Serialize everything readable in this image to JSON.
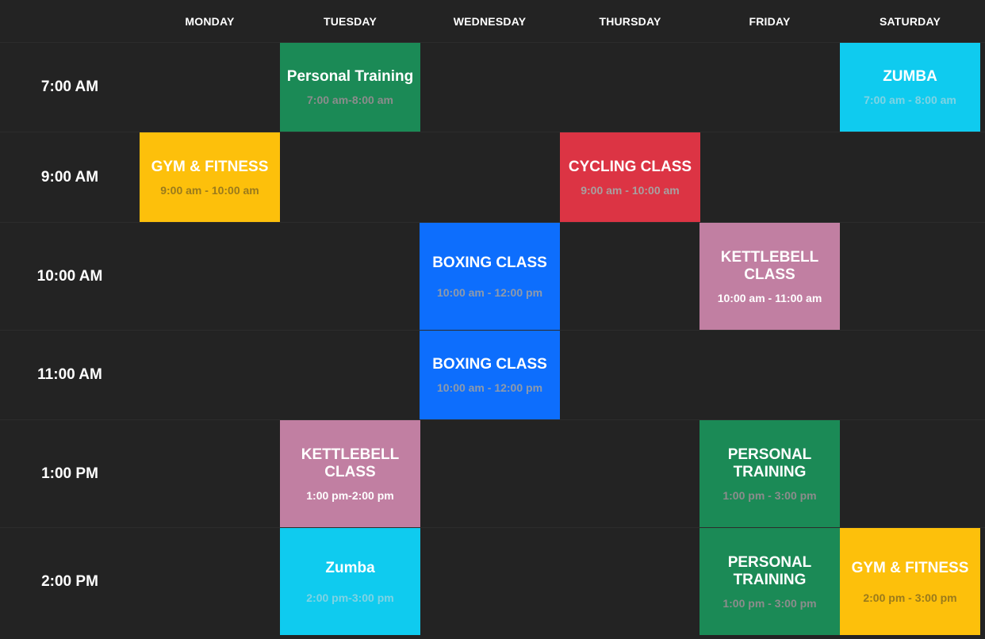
{
  "days": [
    "MONDAY",
    "TUESDAY",
    "WEDNESDAY",
    "THURSDAY",
    "FRIDAY",
    "SATURDAY"
  ],
  "rows": [
    {
      "time": "7:00 AM"
    },
    {
      "time": "9:00 AM"
    },
    {
      "time": "10:00 AM"
    },
    {
      "time": "11:00 AM"
    },
    {
      "time": "1:00 PM"
    },
    {
      "time": "2:00 PM"
    }
  ],
  "events": {
    "r0_tue": {
      "title": "Personal Training",
      "time": "7:00 am-8:00 am",
      "color": "#1b8a56"
    },
    "r0_sat": {
      "title": "ZUMBA",
      "time": "7:00 am - 8:00 am",
      "color": "#0fcbef"
    },
    "r1_mon": {
      "title": "GYM & FITNESS",
      "time": "9:00 am - 10:00 am",
      "color": "#fdc00b"
    },
    "r1_thu": {
      "title": "CYCLING CLASS",
      "time": "9:00 am - 10:00 am",
      "color": "#dc3444"
    },
    "r2_wed": {
      "title": "BOXING CLASS",
      "time": "10:00 am - 12:00 pm",
      "color": "#0d6efd"
    },
    "r2_fri": {
      "title": "KETTLEBELL CLASS",
      "time": "10:00 am - 11:00 am",
      "color": "#c17fa2"
    },
    "r3_wed": {
      "title": "BOXING CLASS",
      "time": "10:00 am - 12:00 pm",
      "color": "#0d6efd"
    },
    "r4_tue": {
      "title": "KETTLEBELL CLASS",
      "time": "1:00 pm-2:00 pm",
      "color": "#c17fa2"
    },
    "r4_fri": {
      "title": "PERSONAL TRAINING",
      "time": "1:00 pm - 3:00 pm",
      "color": "#1b8a56"
    },
    "r5_tue": {
      "title": "Zumba",
      "time": "2:00 pm-3:00 pm",
      "color": "#0fcbef"
    },
    "r5_fri": {
      "title": "PERSONAL TRAINING",
      "time": "1:00 pm - 3:00 pm",
      "color": "#1b8a56"
    },
    "r5_sat": {
      "title": "GYM & FITNESS",
      "time": "2:00 pm - 3:00 pm",
      "color": "#fdc00b"
    }
  }
}
